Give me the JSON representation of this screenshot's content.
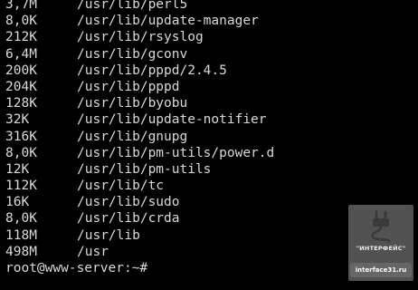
{
  "terminal": {
    "lines": [
      {
        "size": "3,7M",
        "path": "/usr/lib/perl5"
      },
      {
        "size": "8,0K",
        "path": "/usr/lib/update-manager"
      },
      {
        "size": "212K",
        "path": "/usr/lib/rsyslog"
      },
      {
        "size": "6,4M",
        "path": "/usr/lib/gconv"
      },
      {
        "size": "200K",
        "path": "/usr/lib/pppd/2.4.5"
      },
      {
        "size": "204K",
        "path": "/usr/lib/pppd"
      },
      {
        "size": "128K",
        "path": "/usr/lib/byobu"
      },
      {
        "size": "32K",
        "path": "/usr/lib/update-notifier"
      },
      {
        "size": "316K",
        "path": "/usr/lib/gnupg"
      },
      {
        "size": "8,0K",
        "path": "/usr/lib/pm-utils/power.d"
      },
      {
        "size": "12K",
        "path": "/usr/lib/pm-utils"
      },
      {
        "size": "112K",
        "path": "/usr/lib/tc"
      },
      {
        "size": "16K",
        "path": "/usr/lib/sudo"
      },
      {
        "size": "8,0K",
        "path": "/usr/lib/crda"
      },
      {
        "size": "118M",
        "path": "/usr/lib"
      },
      {
        "size": "498M",
        "path": "/usr"
      }
    ],
    "prompt": "root@www-server:~#",
    "text_color": "#d9d9d9",
    "background_color": "#000000"
  },
  "watermark": {
    "icon": "usb-plug-icon",
    "brand": "\"ИНТЕРФЕЙС\"",
    "url": "interface31.ru"
  }
}
